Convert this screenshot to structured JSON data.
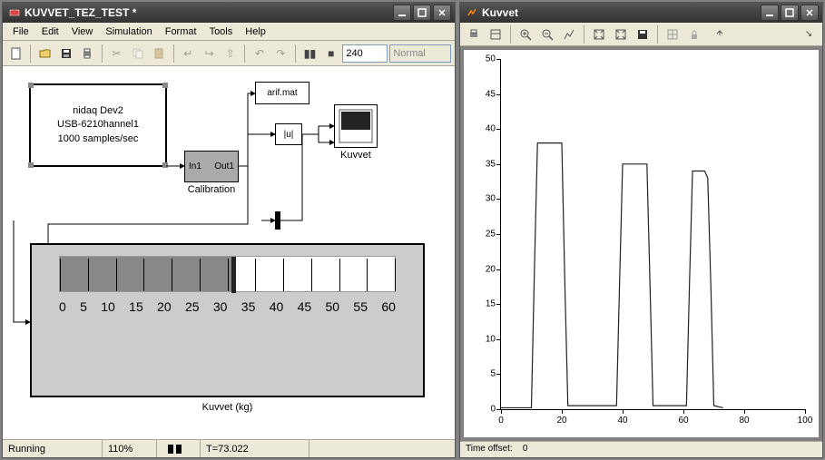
{
  "simulink": {
    "title": "KUVVET_TEZ_TEST *",
    "menu": [
      "File",
      "Edit",
      "View",
      "Simulation",
      "Format",
      "Tools",
      "Help"
    ],
    "sim_time_input": "240",
    "sim_mode": "Normal",
    "blocks": {
      "source_line1": "nidaq Dev2",
      "source_line2": "USB-6210hannel1",
      "source_line3": "1000 samples/sec",
      "calibration_in": "In1",
      "calibration_out": "Out1",
      "calibration_label": "Calibration",
      "tofile": "arif.mat",
      "abs": "|u|",
      "scope_label": "Kuvvet",
      "gauge_label": "Kuvvet (kg)"
    },
    "gauge": {
      "ticks": [
        "0",
        "5",
        "10",
        "15",
        "20",
        "25",
        "30",
        "35",
        "40",
        "45",
        "50",
        "55",
        "60"
      ],
      "value": 31
    },
    "status": {
      "state": "Running",
      "zoom": "110%",
      "time": "T=73.022"
    }
  },
  "figure": {
    "title": "Kuvvet",
    "time_offset_label": "Time offset:",
    "time_offset_value": "0"
  },
  "chart_data": {
    "type": "line",
    "title": "",
    "xlabel": "",
    "ylabel": "",
    "xlim": [
      0,
      100
    ],
    "ylim": [
      0,
      50
    ],
    "xticks": [
      0,
      20,
      40,
      60,
      80,
      100
    ],
    "yticks": [
      0,
      5,
      10,
      15,
      20,
      25,
      30,
      35,
      40,
      45,
      50
    ],
    "series": [
      {
        "name": "Kuvvet",
        "x": [
          0,
          10,
          11,
          12,
          20,
          21,
          22,
          38,
          39,
          40,
          48,
          49,
          50,
          61,
          62,
          63,
          67,
          68,
          69,
          70,
          73
        ],
        "y": [
          0.2,
          0.2,
          20,
          38,
          38,
          18,
          0.5,
          0.5,
          18,
          35,
          35,
          18,
          0.5,
          0.5,
          18,
          34,
          34,
          33,
          18,
          0.5,
          0.2
        ]
      }
    ]
  }
}
